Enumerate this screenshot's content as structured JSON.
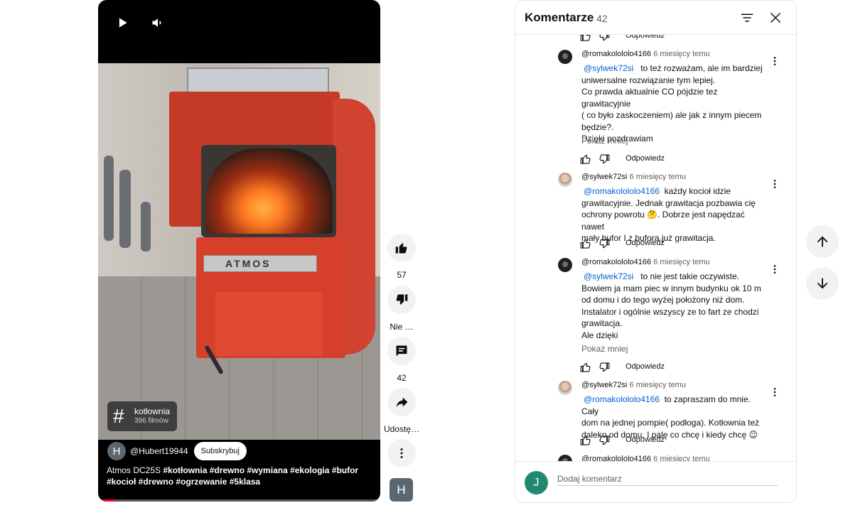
{
  "player": {
    "controls": {
      "play_icon": "play-icon",
      "volume_icon": "volume-icon"
    },
    "boiler_brand": "ATMOS",
    "hashtag_chip": {
      "icon": "hashtag-icon",
      "name": "kotłownia",
      "count": "396 filmów"
    },
    "channel": {
      "avatar_letter": "H",
      "handle": "@Hubert19944",
      "subscribe_label": "Subskrybuj"
    },
    "title_plain": "Atmos DC25S ",
    "title_tags_line1": "#kotłownia #drewno #wymiana  #ekologia  #bufor",
    "title_tags_line2": "#kocioł #drewno #ogrzewanie  #5klasa",
    "progress_fraction": 0.06
  },
  "actions": {
    "like_count": "57",
    "dislike_label": "Nie …",
    "comments_count": "42",
    "share_label": "Udostę…",
    "more_icon": "more-vert-icon",
    "channel_letter": "H"
  },
  "comments_panel": {
    "title": "Komentarze",
    "count": "42",
    "sort_icon": "sort-icon",
    "close_icon": "close-icon",
    "reply_label": "Odpowiedz",
    "show_less_label": "Pokaż mniej",
    "comments": [
      {
        "author": "@romakolololo4166",
        "time": "6 miesięcy temu",
        "mention": "@sylwek72si",
        "lines": [
          "to też rozważam, ale im bardziej",
          "uniwersalne rozwiązanie tym lepiej.",
          "Co prawda aktualnie CO pójdzie tez grawitacyjnie",
          "( co było zaskoczeniem)  ale jak z innym piecem",
          "będzie?.",
          "Dzięki pozdrawiam"
        ]
      },
      {
        "author": "@sylwek72si",
        "time": "6 miesięcy temu",
        "mention": "@romakolololo4166",
        "lines": [
          "każdy kocioł idzie",
          "grawitacyjnie. Jednak grawitacja pozbawia cię",
          "ochrony powrotu 🤔. Dobrze jest napędzać nawet",
          "mały bufor I z bufora już grawitacja."
        ]
      },
      {
        "author": "@romakolololo4166",
        "time": "6 miesięcy temu",
        "mention": "@sylwek72si",
        "lines": [
          "to nie jest takie oczywiste.",
          "Bowiem ja mam piec w innym budynku ok 10 m",
          "od domu i do tego wyżej położony niż dom.",
          "Instalator i ogólnie wszyscy ze to fart ze chodzi",
          "grawitacja.",
          "Ale dzięki"
        ]
      },
      {
        "author": "@sylwek72si",
        "time": "6 miesięcy temu",
        "mention": "@romakolololo4166",
        "lines": [
          "to zapraszam do mnie. Cały",
          "dom na jednej pompie( podłoga). Kotłownia też",
          "daleko od domu.  I palę co chcę i kiedy chcę 😉"
        ]
      },
      {
        "author": "@romakolololo4166",
        "time": "6 miesięcy temu"
      }
    ],
    "add_comment": {
      "avatar_letter": "J",
      "placeholder": "Dodaj komentarz"
    }
  },
  "nav": {
    "up_icon": "arrow-up-icon",
    "down_icon": "arrow-down-icon"
  }
}
